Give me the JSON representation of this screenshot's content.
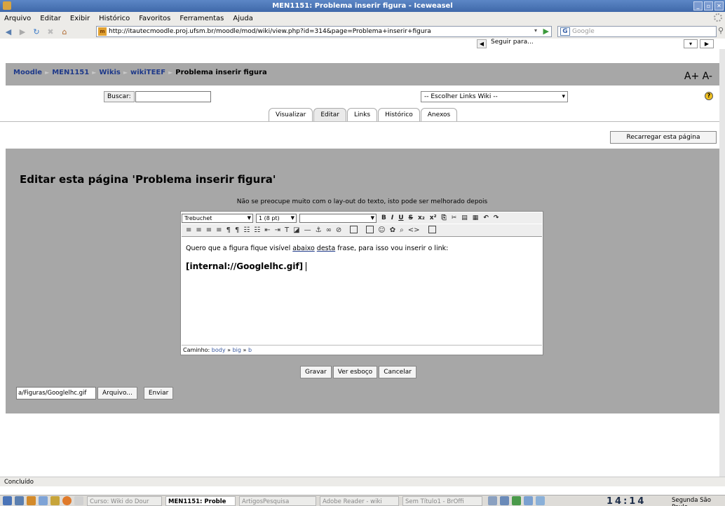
{
  "window": {
    "title": "MEN1151: Problema inserir figura - Iceweasel"
  },
  "menubar": {
    "items": [
      "Arquivo",
      "Editar",
      "Exibir",
      "Histórico",
      "Favoritos",
      "Ferramentas",
      "Ajuda"
    ]
  },
  "navigation": {
    "url": "http://itautecmoodle.proj.ufsm.br/moodle/mod/wiki/view.php?id=314&page=Problema+inserir+figura",
    "search_placeholder": "Google",
    "seguir_label": "Seguir para..."
  },
  "moodle": {
    "breadcrumb": [
      "Moodle",
      "MEN1151",
      "Wikis",
      "wikiTEEF",
      "Problema inserir figura"
    ],
    "font_size_controls": "A+ A-"
  },
  "toolbar": {
    "buscar_label": "Buscar:",
    "wiki_links_select": "-- Escolher Links Wiki --",
    "tabs": [
      "Visualizar",
      "Editar",
      "Links",
      "Histórico",
      "Anexos"
    ],
    "reload_label": "Recarregar esta página"
  },
  "editor": {
    "heading": "Editar esta página 'Problema inserir figura'",
    "note": "Não se preocupe muito com o lay-out do texto, isto pode ser melhorado depois",
    "font_family": "Trebuchet",
    "font_size": "1 (8 pt)",
    "paragraph_text_before": "Quero que a figura fique visível ",
    "paragraph_underline_1": "abaixo",
    "paragraph_space": " ",
    "paragraph_underline_2": "desta",
    "paragraph_text_after": " frase, para isso vou inserir o link:",
    "link_text": "[internal://Googlelhc.gif]",
    "path_label": "Caminho:",
    "path_items": [
      "body",
      "big",
      "b"
    ]
  },
  "buttons": {
    "gravar": "Gravar",
    "ver_esboco": "Ver esboço",
    "cancelar": "Cancelar"
  },
  "upload": {
    "file_value": "a/Figuras/Googlelhc.gif",
    "arquivo_label": "Arquivo...",
    "enviar_label": "Enviar"
  },
  "statusbar": {
    "text": "Concluído"
  },
  "taskbar": {
    "items": [
      "Curso: Wiki do Dour",
      "MEN1151: Proble",
      "ArtigosPesquisa",
      "Adobe Reader - wiki",
      "Sem Título1 - BrOffi"
    ],
    "clock": "14:14",
    "day": "Segunda  São Paulo"
  },
  "colors": {
    "page_bg": "#ffffff",
    "panel_gray": "#a7a7a7",
    "titlebar": "#4a74b8"
  }
}
